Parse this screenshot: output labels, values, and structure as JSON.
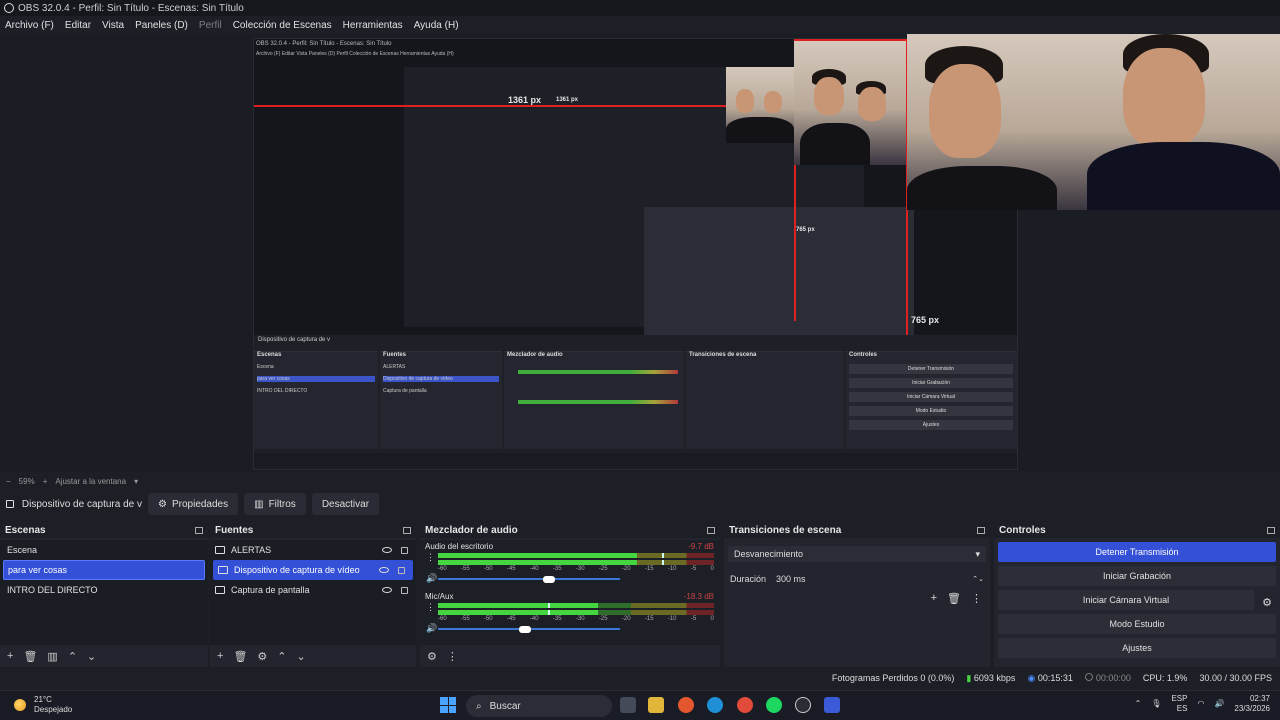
{
  "window": {
    "title": "OBS 32.0.4 - Perfil: Sin Título - Escenas: Sin Título"
  },
  "menu": [
    {
      "label": "Archivo (F)",
      "disabled": false
    },
    {
      "label": "Editar",
      "disabled": false
    },
    {
      "label": "Vista",
      "disabled": false
    },
    {
      "label": "Paneles (D)",
      "disabled": false
    },
    {
      "label": "Perfil",
      "disabled": true
    },
    {
      "label": "Colección de Escenas",
      "disabled": false
    },
    {
      "label": "Herramientas",
      "disabled": false
    },
    {
      "label": "Ayuda (H)",
      "disabled": false
    }
  ],
  "preview": {
    "width_label": "1361 px",
    "width_label_inner": "1361 px",
    "height_label": "765 px",
    "height_label_inner": "765 px",
    "nested_title": "OBS 32.0.4 - Perfil: Sin Título - Escenas: Sin Título",
    "nested_menu": "Archivo (F)   Editar   Vista   Paneles (D)   Perfil   Colección de Escenas   Herramientas   Ayuda (H)",
    "nested_scenes_title": "Escenas",
    "nested_scenes": [
      "Escena",
      "para ver cosas",
      "INTRO DEL DIRECTO"
    ],
    "nested_sources_title": "Fuentes",
    "nested_sources": [
      "ALERTAS",
      "Dispositivo de captura de vídeo",
      "Captura de pantalla"
    ],
    "nested_mixer_title": "Mezclador de audio",
    "nested_transitions_title": "Transiciones de escena",
    "nested_controls_title": "Controles",
    "nested_controls": [
      "Detener Transmisión",
      "Iniciar Grabación",
      "Iniciar Cámara Virtual",
      "Modo Estudio",
      "Ajustes"
    ]
  },
  "zoom": {
    "minus": "−",
    "value": "59%",
    "plus": "+",
    "fit": "Ajustar a la ventana"
  },
  "source_toolbar": {
    "source_name": "Dispositivo de captura de v",
    "properties": "Propiedades",
    "filters": "Filtros",
    "deactivate": "Desactivar"
  },
  "scenes": {
    "title": "Escenas",
    "items": [
      {
        "label": "Escena",
        "selected": false
      },
      {
        "label": "para ver cosas",
        "selected": true
      },
      {
        "label": "INTRO DEL DIRECTO",
        "selected": false
      }
    ]
  },
  "sources": {
    "title": "Fuentes",
    "items": [
      {
        "label": "ALERTAS",
        "icon": "browser-source-icon",
        "selected": false
      },
      {
        "label": "Dispositivo de captura de vídeo",
        "icon": "camera-icon",
        "selected": true
      },
      {
        "label": "Captura de pantalla",
        "icon": "monitor-icon",
        "selected": false
      }
    ]
  },
  "mixer": {
    "title": "Mezclador de audio",
    "ticks": [
      "-60",
      "-55",
      "-50",
      "-45",
      "-40",
      "-35",
      "-30",
      "-25",
      "-20",
      "-15",
      "-10",
      "-5",
      "0"
    ],
    "channels": [
      {
        "name": "Audio del escritorio",
        "db": "-9.7 dB",
        "level": 0.72,
        "peak": 0.81,
        "fader": 0.61
      },
      {
        "name": "Mic/Aux",
        "db": "-18.3 dB",
        "level": 0.58,
        "peak": 0.4,
        "fader": 0.48
      }
    ]
  },
  "transitions": {
    "title": "Transiciones de escena",
    "selected": "Desvanecimiento",
    "duration_label": "Duración",
    "duration_value": "300 ms"
  },
  "controls": {
    "title": "Controles",
    "buttons": [
      {
        "label": "Detener Transmisión",
        "active": true
      },
      {
        "label": "Iniciar Grabación",
        "active": false
      },
      {
        "label": "Iniciar Cámara Virtual",
        "active": false
      },
      {
        "label": "Modo Estudio",
        "active": false
      },
      {
        "label": "Ajustes",
        "active": false
      }
    ]
  },
  "status": {
    "dropped": "Fotogramas Perdidos 0 (0.0%)",
    "bitrate": "6093 kbps",
    "stream_time": "00:15:31",
    "rec_time": "00:00:00",
    "cpu": "CPU: 1.9%",
    "fps": "30.00 / 30.00 FPS"
  },
  "taskbar": {
    "weather_temp": "21°C",
    "weather_desc": "Despejado",
    "search_placeholder": "Buscar",
    "lang_top": "ESP",
    "lang_bottom": "ES",
    "time": "02:37",
    "date": "23/3/2026"
  },
  "colors": {
    "accent": "#3350d6",
    "guide": "#e02020",
    "meter_green": "#45d541"
  }
}
